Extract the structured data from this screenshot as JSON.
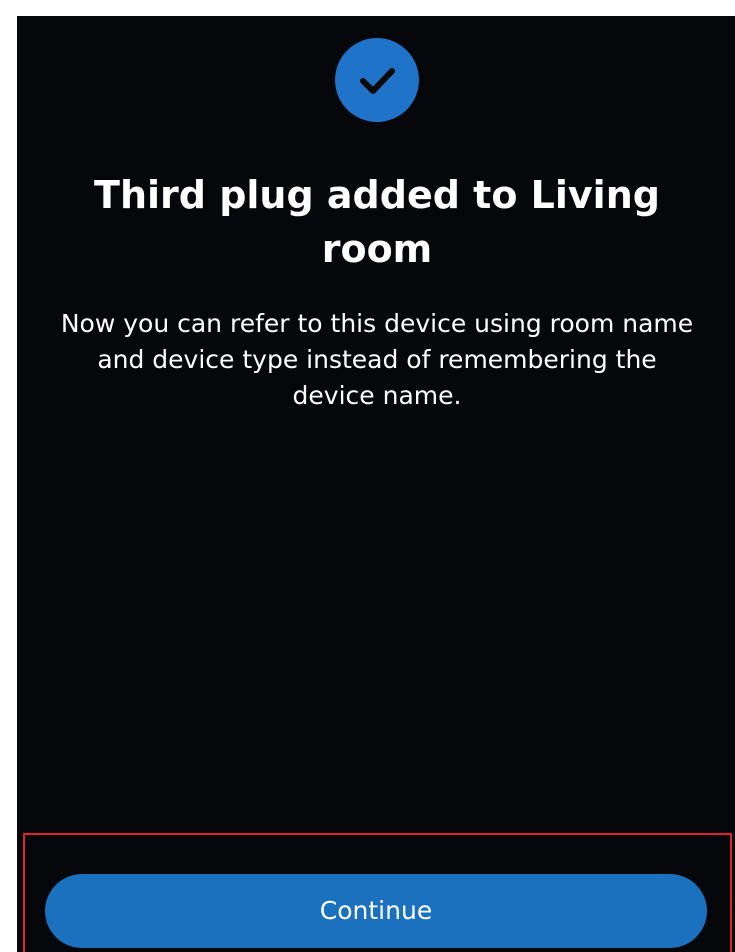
{
  "header": {
    "status_icon": "checkmark-icon",
    "accent_color": "#1f73c8"
  },
  "main": {
    "title": "Third plug added to Living room",
    "description": "Now you can refer to this device using room name and device type instead of remembering the device name."
  },
  "footer": {
    "continue_label": "Continue",
    "button_color": "#1a72bf",
    "highlight_color": "#e0222a"
  }
}
